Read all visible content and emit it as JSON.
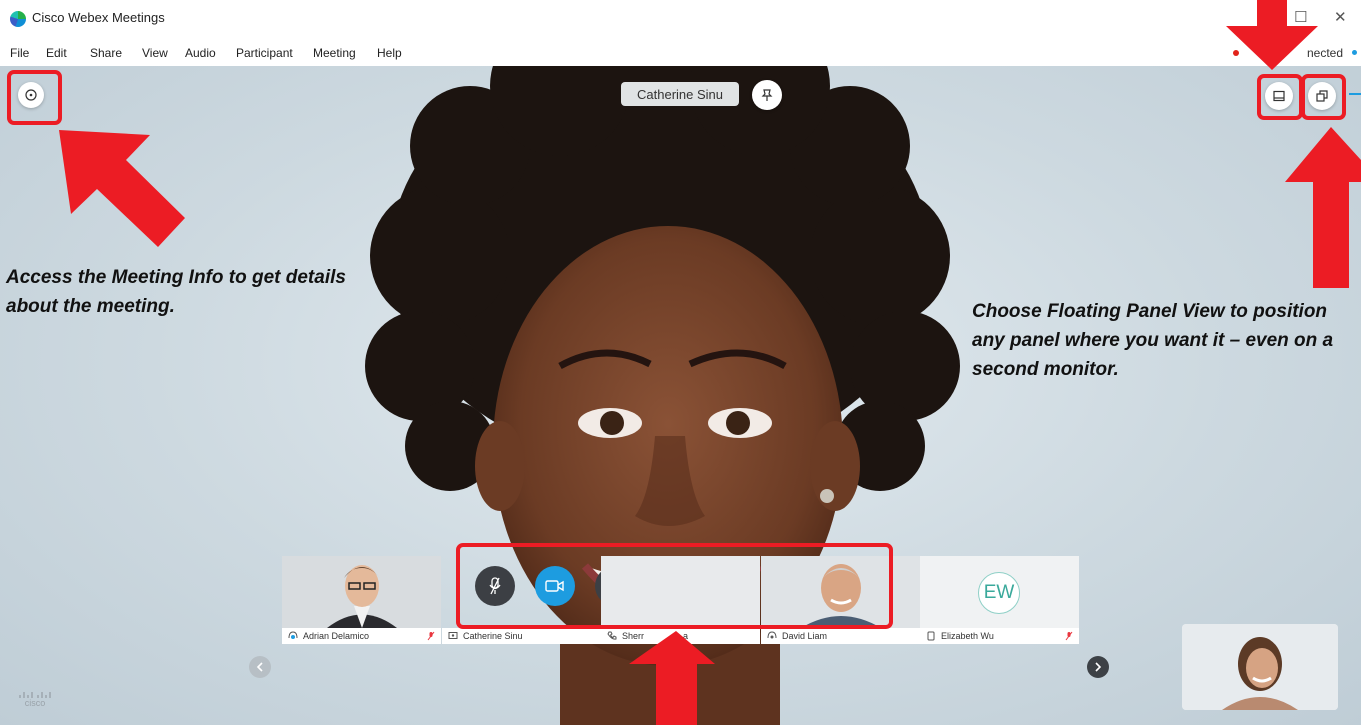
{
  "window": {
    "title": "Cisco Webex Meetings",
    "minimize": "—",
    "maximize": "☐",
    "close": "✕"
  },
  "menu": [
    "File",
    "Edit",
    "Share",
    "View",
    "Audio",
    "Participant",
    "Meeting",
    "Help"
  ],
  "status": {
    "connection": "nected"
  },
  "speaker": {
    "name": "Catherine Sinu"
  },
  "controls": [
    {
      "name": "mute-button",
      "icon": "microphone-muted-icon"
    },
    {
      "name": "video-button",
      "icon": "camera-icon"
    },
    {
      "name": "share-button",
      "icon": "upload-icon"
    },
    {
      "name": "participants-button",
      "icon": "participants-icon"
    },
    {
      "name": "chat-button",
      "icon": "chat-bubble-icon"
    },
    {
      "name": "more-button",
      "label": "···",
      "icon": "more-icon"
    },
    {
      "name": "leave-button",
      "icon": "close-icon"
    }
  ],
  "callouts": {
    "meeting_info": "Access the Meeting Info to get details about the meeting.",
    "floating_panel": "Choose Floating Panel View to position any panel where you want it – even on a second monitor."
  },
  "participants": [
    {
      "name": "Adrian Delamico",
      "icon": "headset-icon",
      "muted": true
    },
    {
      "name": "Catherine Sinu",
      "icon": "screen-icon",
      "muted": false
    },
    {
      "name": "Sherr",
      "name_tail": "a",
      "icon": "phone-icon",
      "muted": false
    },
    {
      "name": "David Liam",
      "icon": "headset-icon",
      "muted": false
    },
    {
      "name": "Elizabeth Wu",
      "initials": "EW",
      "icon": "device-icon",
      "muted": true
    }
  ],
  "brand": {
    "logo_text": "cisco"
  },
  "colors": {
    "accent": "#1d9ce0",
    "danger": "#e9363f",
    "annotation_red": "#ec1c24",
    "control_dark": "#3c3f44"
  }
}
